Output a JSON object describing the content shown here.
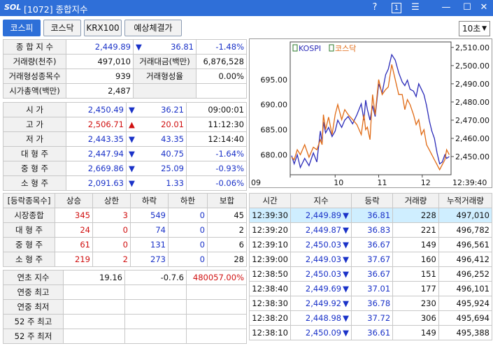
{
  "window": {
    "logo": "SOL",
    "title": "[1072] 종합지수",
    "help": "?",
    "num_box": "1",
    "menu": "☰",
    "minimize": "—",
    "maximize": "☐",
    "close": "✕"
  },
  "tabs": [
    {
      "label": "코스피",
      "active": true
    },
    {
      "label": "코스닥"
    },
    {
      "label": "KRX100"
    },
    {
      "label": "예상체결가"
    }
  ],
  "interval": {
    "value": "10초"
  },
  "summary": {
    "r1": {
      "label": "종 합 지 수",
      "value": "2,449.89",
      "arrow": "▼",
      "change": "36.81",
      "pct": "-1.48%"
    },
    "r2": {
      "l1": "거래량(천주)",
      "v1": "497,010",
      "l2": "거래대금(백만)",
      "v2": "6,876,528"
    },
    "r3": {
      "l1": "거래형성종목수",
      "v1": "939",
      "l2": "거래형성율",
      "v2": "0.00%"
    },
    "r4": {
      "l1": "시가총액(백만)",
      "v1": "2,487"
    }
  },
  "prices": [
    {
      "label": "시 가",
      "value": "2,450.49",
      "arrow": "▼",
      "dir": "down",
      "change": "36.21",
      "extra": "09:00:01"
    },
    {
      "label": "고 가",
      "value": "2,506.71",
      "arrow": "▲",
      "dir": "up",
      "change": "20.01",
      "extra": "11:12:30"
    },
    {
      "label": "저 가",
      "value": "2,443.35",
      "arrow": "▼",
      "dir": "down",
      "change": "43.35",
      "extra": "12:14:40"
    },
    {
      "label": "대 형 주",
      "value": "2,447.94",
      "arrow": "▼",
      "dir": "down",
      "change": "40.75",
      "extra": "-1.64%"
    },
    {
      "label": "중 형 주",
      "value": "2,669.86",
      "arrow": "▼",
      "dir": "down",
      "change": "25.09",
      "extra": "-0.93%"
    },
    {
      "label": "소 형 주",
      "value": "2,091.63",
      "arrow": "▼",
      "dir": "down",
      "change": "1.33",
      "extra": "-0.06%"
    }
  ],
  "breadth": {
    "headers": [
      "[등락종목수]",
      "상승",
      "상한",
      "하락",
      "하한",
      "보합"
    ],
    "rows": [
      {
        "label": "시장종합",
        "c": [
          "345",
          "3",
          "549",
          "0",
          "45"
        ]
      },
      {
        "label": "대 형 주",
        "c": [
          "24",
          "0",
          "74",
          "0",
          "2"
        ]
      },
      {
        "label": "중 형 주",
        "c": [
          "61",
          "0",
          "131",
          "0",
          "6"
        ]
      },
      {
        "label": "소 형 주",
        "c": [
          "219",
          "2",
          "273",
          "0",
          "28"
        ]
      }
    ]
  },
  "yearly": {
    "r1": {
      "label": "연초 지수",
      "v1": "19.16",
      "v2": "-0.7.6",
      "v3": "480057.00%"
    },
    "rows": [
      "연중 최고",
      "연중 최저",
      "52 주 최고",
      "52 주 최저"
    ]
  },
  "chart_data": {
    "type": "line",
    "legend": [
      "KOSPI",
      "코스닥"
    ],
    "x_ticks": [
      "09",
      "10",
      "11",
      "12"
    ],
    "last_time": "12:39:40",
    "left_axis": {
      "ticks": [
        "695.00",
        "690.00",
        "685.00",
        "680.00"
      ],
      "range": [
        676.0,
        702.5
      ]
    },
    "right_axis": {
      "ticks": [
        "2,510.00",
        "2,500.00",
        "2,490.00",
        "2,480.00",
        "2,470.00",
        "2,460.00",
        "2,450.00"
      ],
      "range": [
        2440,
        2513
      ]
    },
    "series": [
      {
        "name": "KOSPI",
        "color": "#2a2ab8",
        "axis": "right",
        "x": [
          0,
          0.06,
          0.13,
          0.2,
          0.3,
          0.4,
          0.5,
          0.58,
          0.66,
          0.7,
          0.73,
          0.78,
          0.85,
          0.93,
          1.0,
          1.06,
          1.15,
          1.22,
          1.3,
          1.4,
          1.5,
          1.6,
          1.66,
          1.7,
          1.74,
          1.8,
          1.86,
          1.92,
          2.0,
          2.08,
          2.16,
          2.22,
          2.3,
          2.38,
          2.46,
          2.54,
          2.6,
          2.66,
          2.72,
          2.8,
          2.86,
          2.92,
          2.98,
          3.04,
          3.1,
          3.16,
          3.22,
          3.28,
          3.34,
          3.4,
          3.46,
          3.52,
          3.56,
          3.62
        ],
        "y": [
          2450.5,
          2446,
          2451,
          2444,
          2449,
          2445,
          2452,
          2447,
          2464,
          2458,
          2469,
          2463,
          2466,
          2461,
          2464,
          2470,
          2466,
          2470,
          2472,
          2468,
          2473,
          2479,
          2470,
          2481,
          2476,
          2470,
          2478,
          2472,
          2490,
          2485,
          2495,
          2498,
          2506,
          2503,
          2496,
          2491,
          2489,
          2492,
          2487,
          2486,
          2483,
          2490,
          2487,
          2484,
          2478,
          2470,
          2464,
          2460,
          2452,
          2446,
          2447,
          2451,
          2449,
          2450
        ]
      },
      {
        "name": "코스닥",
        "color": "#e06a14",
        "axis": "left",
        "x": [
          0,
          0.06,
          0.13,
          0.2,
          0.3,
          0.4,
          0.5,
          0.58,
          0.66,
          0.7,
          0.73,
          0.78,
          0.85,
          0.93,
          1.0,
          1.06,
          1.15,
          1.22,
          1.3,
          1.4,
          1.5,
          1.6,
          1.66,
          1.7,
          1.74,
          1.8,
          1.86,
          1.92,
          2.0,
          2.08,
          2.16,
          2.22,
          2.3,
          2.38,
          2.46,
          2.54,
          2.6,
          2.66,
          2.72,
          2.8,
          2.86,
          2.92,
          2.98,
          3.04,
          3.1,
          3.16,
          3.22,
          3.28,
          3.34,
          3.4,
          3.46,
          3.52,
          3.56,
          3.62
        ],
        "y": [
          679.5,
          679,
          681,
          680,
          682,
          679.5,
          681.5,
          681,
          683,
          682,
          688,
          685,
          687.5,
          684,
          688,
          690,
          687,
          689,
          688,
          687,
          686,
          684,
          688,
          685,
          685.5,
          683,
          692,
          688,
          695,
          692,
          693,
          693.5,
          698,
          695,
          692,
          692,
          689,
          691,
          690,
          688,
          686,
          687,
          684,
          685,
          682,
          681,
          680,
          679,
          678,
          677,
          678,
          679,
          681,
          680
        ]
      }
    ]
  }
}
